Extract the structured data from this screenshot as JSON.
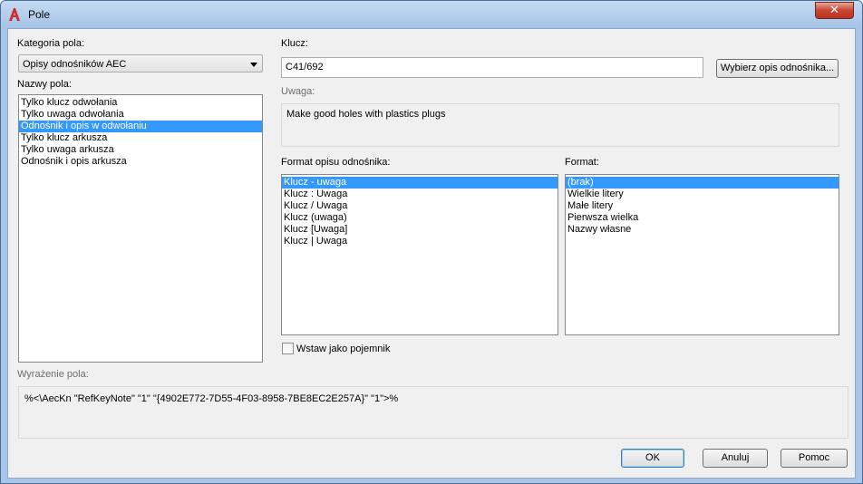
{
  "window": {
    "title": "Pole"
  },
  "category": {
    "label": "Kategoria pola:",
    "value": "Opisy odnośników AEC"
  },
  "field_names": {
    "label": "Nazwy pola:",
    "items": [
      "Tylko klucz odwołania",
      "Tylko uwaga odwołania",
      "Odnośnik i opis w odwołaniu",
      "Tylko klucz arkusza",
      "Tylko uwaga arkusza",
      "Odnośnik i opis arkusza"
    ],
    "selected": "Odnośnik i opis w odwołaniu"
  },
  "key": {
    "label": "Klucz:",
    "value": "C41/692",
    "browse_button": "Wybierz opis odnośnika..."
  },
  "note": {
    "label": "Uwaga:",
    "value": "Make good holes with plastics plugs"
  },
  "keynote_format": {
    "label": "Format opisu odnośnika:",
    "items": [
      "Klucz - uwaga",
      "Klucz : Uwaga",
      "Klucz / Uwaga",
      "Klucz (uwaga)",
      "Klucz [Uwaga]",
      "Klucz | Uwaga"
    ],
    "selected": "Klucz - uwaga"
  },
  "format": {
    "label": "Format:",
    "items": [
      "(brak)",
      "Wielkie litery",
      "Małe litery",
      "Pierwsza wielka",
      "Nazwy własne"
    ],
    "selected": "(brak)"
  },
  "insert_as_placeholder": {
    "label": "Wstaw jako pojemnik",
    "checked": false
  },
  "field_expression": {
    "label": "Wyrażenie pola:",
    "value": "%<\\AecKn \"RefKeyNote\" \"1\" \"{4902E772-7D55-4F03-8958-7BE8EC2E257A}\" \"1\">%"
  },
  "buttons": {
    "ok": "OK",
    "cancel": "Anuluj",
    "help": "Pomoc"
  },
  "colors": {
    "selection": "#3399ff",
    "dialog_bg": "#f0f0f0",
    "app_icon_red": "#d12a2a"
  }
}
